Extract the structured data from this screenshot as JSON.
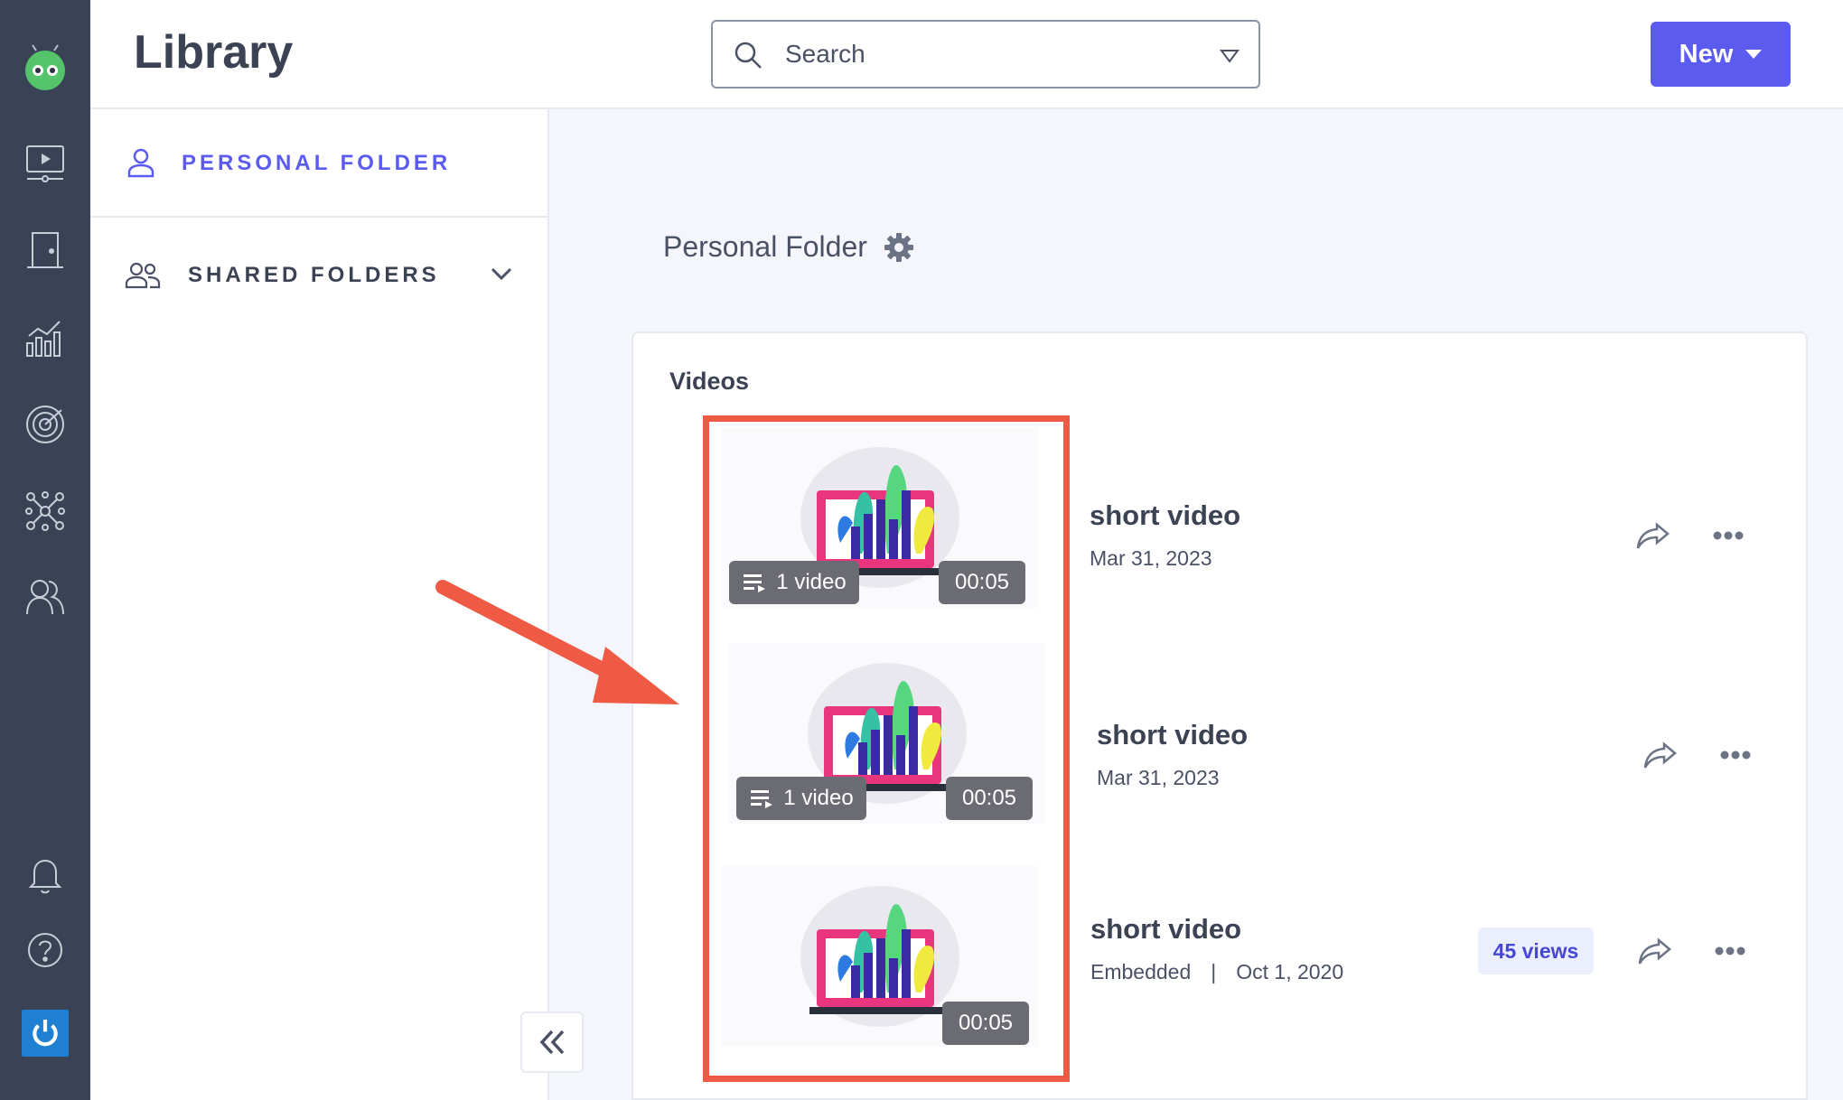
{
  "rail": {
    "icons": [
      "robot-logo-icon",
      "video-monitor-icon",
      "door-icon",
      "analytics-icon",
      "target-icon",
      "network-icon",
      "users-icon",
      "bell-icon",
      "help-icon",
      "power-icon"
    ]
  },
  "header": {
    "title": "Library",
    "search_placeholder": "Search",
    "new_label": "New"
  },
  "sidebar": {
    "personal_folder": "PERSONAL FOLDER",
    "shared_folders": "SHARED FOLDERS"
  },
  "main": {
    "folder_name": "Personal Folder",
    "section": "Videos",
    "videos": [
      {
        "title": "short video",
        "date": "Mar 31, 2023",
        "count_label": "1 video",
        "duration": "00:05"
      },
      {
        "title": "short video",
        "date": "Mar 31, 2023",
        "count_label": "1 video",
        "duration": "00:05"
      },
      {
        "title": "short video",
        "status": "Embedded",
        "separator": "|",
        "date": "Oct 1, 2020",
        "duration": "00:05",
        "views": "45 views"
      }
    ]
  },
  "colors": {
    "accent": "#5b5bf0",
    "rail": "#3a4256",
    "highlight": "#ef5a44"
  }
}
